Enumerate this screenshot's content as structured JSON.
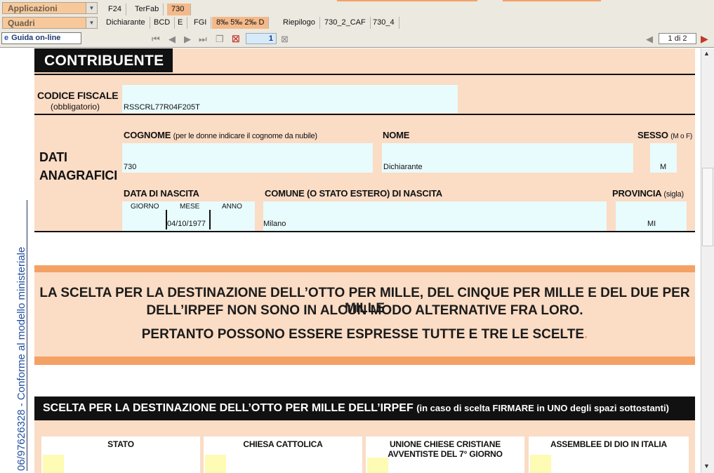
{
  "toolbar": {
    "applicazioni_label": "Applicazioni",
    "quadri_label": "Quadri",
    "app_tabs": [
      "F24",
      "TerFab",
      "730"
    ],
    "app_tab_active": "730",
    "quadri_tabs": [
      "Dichiarante",
      "BCD",
      "E",
      "FGI",
      "8‰ 5‰ 2‰ D",
      "Riepilogo",
      "730_2_CAF",
      "730_4"
    ],
    "quadri_tab_active": "8‰ 5‰ 2‰ D"
  },
  "nav": {
    "guida_label": "Guida on-line",
    "page_number": "1",
    "page_indicator": "1 di 2"
  },
  "sidebar": {
    "vertical_text": "06/97626328 - Conforme al modello ministeriale"
  },
  "form": {
    "contribuente_title": "CONTRIBUENTE",
    "codice_fiscale_label": "CODICE FISCALE",
    "codice_fiscale_sub": "(obbligatorio)",
    "codice_fiscale_value": "RSSCRL77R04F205T",
    "dati_anagrafici_label_1": "DATI",
    "dati_anagrafici_label_2": "ANAGRAFICI",
    "cognome_label": "COGNOME",
    "cognome_note": "(per le donne indicare il cognome da nubile)",
    "cognome_value": "730",
    "nome_label": "NOME",
    "nome_value": "Dichiarante",
    "sesso_label": "SESSO",
    "sesso_note": "(M o F)",
    "sesso_value": "M",
    "data_nascita_label": "DATA DI NASCITA",
    "giorno_label": "GIORNO",
    "mese_label": "MESE",
    "anno_label": "ANNO",
    "data_nascita_value": "04/10/1977",
    "comune_label": "COMUNE (O STATO ESTERO) DI NASCITA",
    "comune_value": "Milano",
    "provincia_label": "PROVINCIA",
    "provincia_note": "(sigla)",
    "provincia_value": "MI"
  },
  "notice": {
    "line1": "LA SCELTA PER LA DESTINAZIONE DELL’OTTO PER MILLE, DEL CINQUE PER MILLE E DEL DUE PER MILLE",
    "line2": "DELL’IRPEF NON SONO IN ALCUN MODO ALTERNATIVE FRA LORO.",
    "line3": "PERTANTO POSSONO ESSERE ESPRESSE TUTTE E TRE LE SCELTE",
    "line3_end": "."
  },
  "otto_per_mille": {
    "title": "SCELTA PER LA DESTINAZIONE DELL’OTTO PER MILLE DELL’IRPEF",
    "note": "(in caso di scelta FIRMARE in UNO degli spazi sottostanti)",
    "options": [
      "STATO",
      "CHIESA CATTOLICA",
      "UNIONE CHIESE CRISTIANE AVVENTISTE DEL 7° GIORNO",
      "ASSEMBLEE DI DIO IN ITALIA"
    ]
  },
  "colors": {
    "peach": "#fbdcc5",
    "orange_band": "#f4a165",
    "field_bg": "#e8fbfd",
    "signature_bg": "#fdfbb4",
    "vertical_text": "#1f4e9e"
  }
}
